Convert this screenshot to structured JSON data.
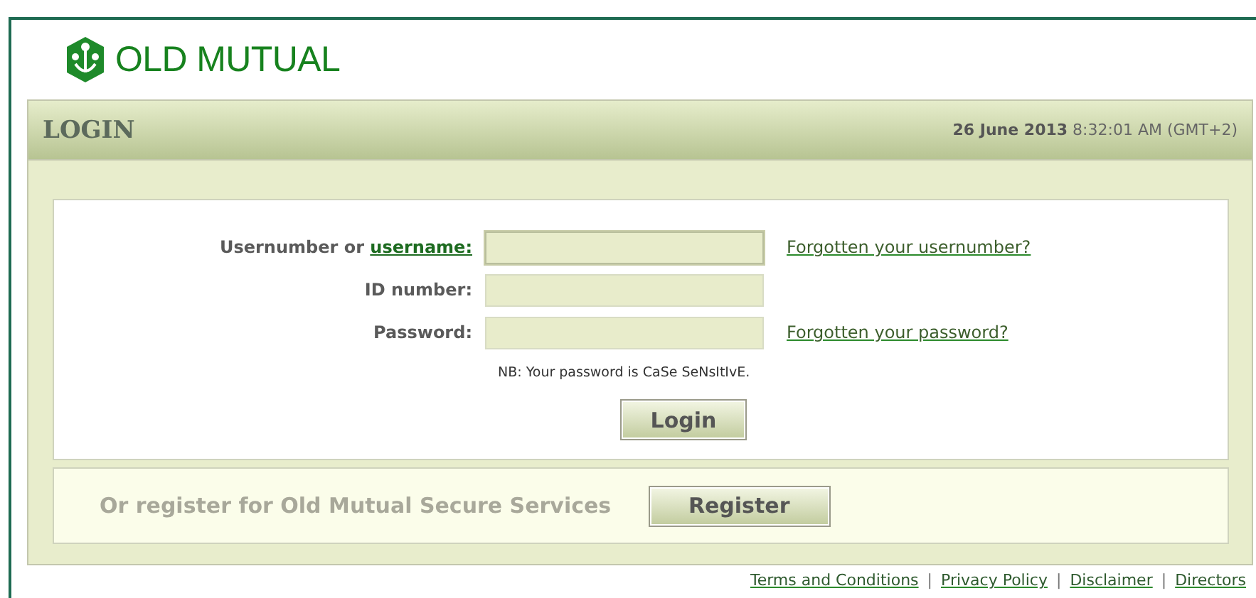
{
  "brand": {
    "name": "OLD MUTUAL"
  },
  "panel": {
    "title": "LOGIN",
    "datetime": "**26 June 2013** 8:32:01 AM (GMT+2)"
  },
  "form": {
    "fields": [
      {
        "label": "Usernumber or ",
        "label_link": "username:",
        "focused": true,
        "help_link": "Forgotten your usernumber?"
      },
      {
        "label": "ID number:",
        "focused": false
      },
      {
        "label": "Password:",
        "focused": false,
        "help_link": "Forgotten your password?"
      }
    ],
    "note": "NB: Your password is CaSe SeNsItIvE.",
    "submit": "Login"
  },
  "register": {
    "text": "Or register for Old Mutual Secure Services",
    "button": "Register"
  },
  "footer": {
    "separator": "|",
    "links": [
      "Terms and Conditions",
      "Privacy Policy",
      "Disclaimer",
      "Directors"
    ]
  }
}
